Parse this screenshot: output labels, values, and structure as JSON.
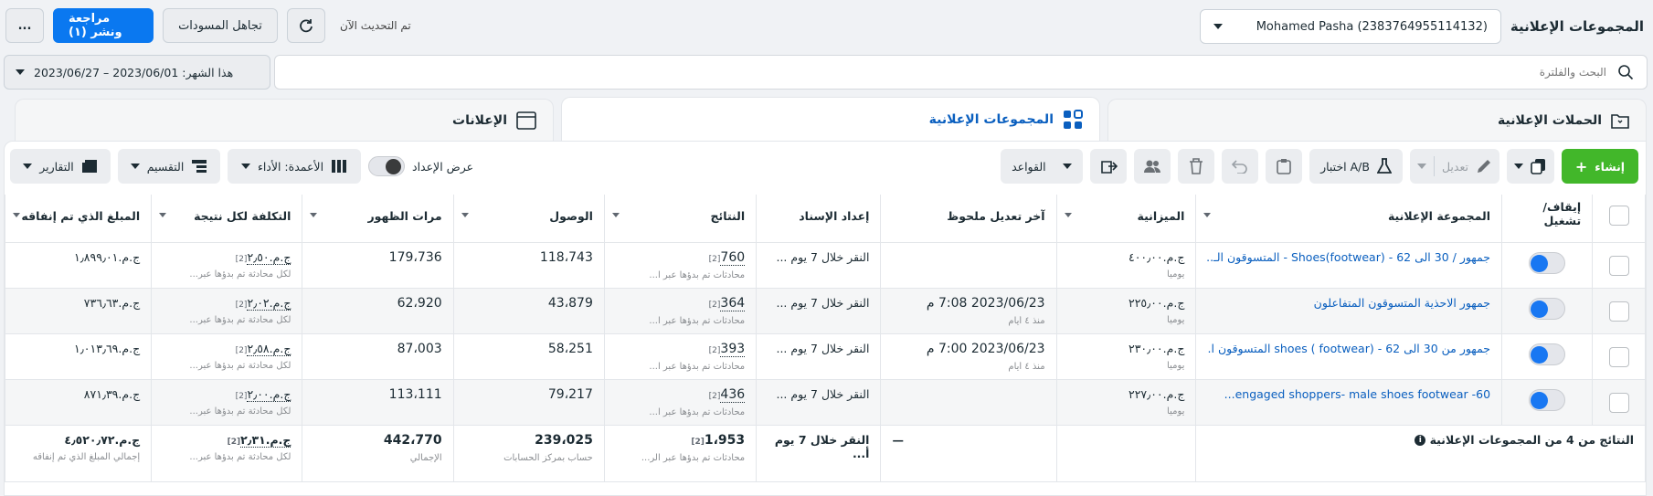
{
  "header": {
    "title": "المجموعات الإعلانية",
    "account": "Mohamed Pasha (2383764955114132)",
    "updated_text": "تم التحديث الآن",
    "discard_drafts": "تجاهل المسودات",
    "review_publish": "مراجعة ونشر (١)",
    "more": "..."
  },
  "search": {
    "placeholder": "البحث والفلترة",
    "date_range": "هذا الشهر: 2023/06/01 – 2023/06/27"
  },
  "tabs": [
    {
      "label": "الحملات الإعلانية",
      "icon": "folder-icon"
    },
    {
      "label": "المجموعات الإعلانية",
      "icon": "grid-icon"
    },
    {
      "label": "الإعلانات",
      "icon": "ad-icon"
    }
  ],
  "toolbar": {
    "create": "إنشاء",
    "edit": "تعديل",
    "ab_test": "اختبار A/B",
    "rules": "القواعد",
    "setup_view": "عرض الإعداد",
    "columns": "الأعمدة: الأداء",
    "breakdown": "التقسيم",
    "reports": "التقارير"
  },
  "table": {
    "headers": [
      "إيقاف/تشغيل",
      "المجموعة الإعلانية",
      "الميزانية",
      "آخر تعديل ملحوظ",
      "إعداد الإسناد",
      "النتائج",
      "الوصول",
      "مرات الظهور",
      "التكلفة لكل نتيجة",
      "المبلغ الذي تم إنفاقه"
    ],
    "rows": [
      {
        "name": "جمهور / 30 الى 62 - Shoes(footwear) - المتسوقون الـ...",
        "budget": "ج.م.٤٠٠٫٠٠",
        "budget_sub": "يومياً",
        "edited": "",
        "edited_sub": "",
        "attribution": "النقر خلال 7 يوم ...",
        "results": "760",
        "results_sub": "محادثات تم بدؤها عبر ا...",
        "reach": "118،743",
        "impressions": "179،736",
        "cpr": "ج.م.٢٫٥٠",
        "cpr_sub": "لكل محادثة تم بدؤها عبر...",
        "spent": "ج.م.١٫٨٩٩٫٠١"
      },
      {
        "name": "جمهور الاحذية المتسوقون المتفاعلون",
        "budget": "ج.م.٢٢٥٫٠٠",
        "budget_sub": "يومياً",
        "edited": "2023/06/23 7:08 م",
        "edited_sub": "منذ ٤ أيام",
        "attribution": "النقر خلال 7 يوم ...",
        "results": "364",
        "results_sub": "محادثات تم بدؤها عبر ا...",
        "reach": "43،879",
        "impressions": "62،920",
        "cpr": "ج.م.٢٫٠٢",
        "cpr_sub": "لكل محادثة تم بدؤها عبر...",
        "spent": "ج.م.٧٣٦٫٦٣"
      },
      {
        "name": "جمهور من 30 الى 62 - shoes ( footwear) المتسوقون ا...",
        "budget": "ج.م.٢٣٠٫٠٠",
        "budget_sub": "يومياً",
        "edited": "2023/06/23 7:00 م",
        "edited_sub": "منذ ٤ أيام",
        "attribution": "النقر خلال 7 يوم ...",
        "results": "393",
        "results_sub": "محادثات تم بدؤها عبر ا...",
        "reach": "58،251",
        "impressions": "87،003",
        "cpr": "ج.م.٢٫٥٨",
        "cpr_sub": "لكل محادثة تم بدؤها عبر...",
        "spent": "ج.م.١٫٠١٣٫٦٩"
      },
      {
        "name": "60- engaged shoppers- male shoes footwear...",
        "budget": "ج.م.٢٢٧٫٠٠",
        "budget_sub": "يومياً",
        "edited": "",
        "edited_sub": "",
        "attribution": "النقر خلال 7 يوم ...",
        "results": "436",
        "results_sub": "محادثات تم بدؤها عبر ا...",
        "reach": "79،217",
        "impressions": "113،111",
        "cpr": "ج.م.٢٫٠٠",
        "cpr_sub": "لكل محادثة تم بدؤها عبر...",
        "spent": "ج.م.٨٧١٫٣٩"
      }
    ],
    "total": {
      "label": "النتائج من 4 من المجموعات الإعلانية",
      "edited": "—",
      "attribution": "النقر خلال 7 يوم أ...",
      "results": "1،953",
      "results_sub": "محادثات تم بدؤها عبر الر...",
      "reach": "239،025",
      "reach_sub": "حساب بمركز الحسابات",
      "impressions": "442،770",
      "impressions_sub": "الإجمالي",
      "cpr": "ج.م.٢٫٣١",
      "cpr_sub": "لكل محادثة تم بدؤها عبر...",
      "spent": "ج.م.٤٫٥٢٠٫٧٢",
      "spent_sub": "إجمالي المبلغ الذي تم إنفاقه"
    },
    "badge": "[2]"
  }
}
